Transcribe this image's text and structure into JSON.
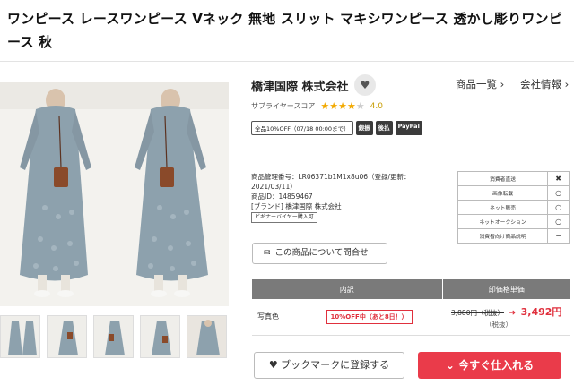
{
  "product": {
    "title": "ワンピース レースワンピース Vネック 無地 スリット マキシワンピース 透かし彫りワンピース 秋"
  },
  "supplier": {
    "name": "橋津国際 株式会社",
    "score_label": "サプライヤースコア",
    "score_value": "4.0",
    "rating_stars": 4
  },
  "nav": {
    "product_list": "商品一覧 ›",
    "company_info": "会社情報 ›"
  },
  "badges": {
    "promo": "全品10%OFF（07/18 00:00まで）",
    "tags": [
      "銀振",
      "後払",
      "PayPal"
    ]
  },
  "info": {
    "line1": "商品管理番号：LR06371b1M1x8u06（登録/更新：",
    "line2": "2021/03/11）",
    "line3": "商品ID：14859467",
    "line4": "[ブランド] 橋津国際 株式会社",
    "tag": "ビギナーバイヤー購入可"
  },
  "inquiry": {
    "label": "この商品について問合せ"
  },
  "permissions": [
    {
      "label": "消費者直送",
      "mark": "✖"
    },
    {
      "label": "画像転載",
      "mark": "○"
    },
    {
      "label": "ネット販売",
      "mark": "○"
    },
    {
      "label": "ネットオークション",
      "mark": "○"
    },
    {
      "label": "消費者向け商品説明",
      "mark": "−"
    }
  ],
  "price_table": {
    "col1": "内訳",
    "col2": "卸価格単価",
    "rows": [
      {
        "variant": "写真色",
        "promo": "10%OFF中（あと8日！）",
        "old_price": "3,880円（税抜）",
        "new_price": "3,492円",
        "tax": "（税抜）"
      }
    ]
  },
  "actions": {
    "bookmark": "ブックマークに登録する",
    "buy": "今すぐ仕入れる"
  },
  "colors": {
    "accent": "#ea3b4a",
    "dress": "#8da1ad",
    "star": "#f2a900"
  }
}
